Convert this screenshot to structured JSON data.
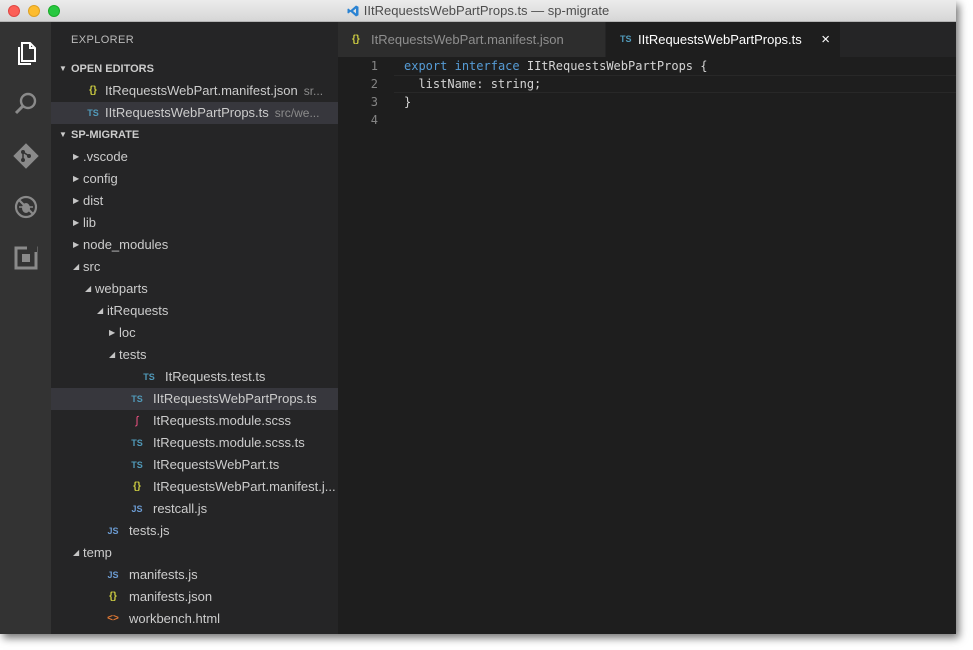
{
  "window": {
    "title": "IItRequestsWebPartProps.ts — sp-migrate"
  },
  "activity_bar": {
    "icons": [
      "files-icon",
      "search-icon",
      "git-icon",
      "debug-icon",
      "extensions-icon"
    ]
  },
  "sidebar": {
    "title": "EXPLORER",
    "open_editors_label": "OPEN EDITORS",
    "open_editors": [
      {
        "icon": "{}",
        "icon_type": "json",
        "name": "ItRequestsWebPart.manifest.json",
        "path": "sr..."
      },
      {
        "icon": "TS",
        "icon_type": "ts",
        "name": "IItRequestsWebPartProps.ts",
        "path": "src/we..."
      }
    ],
    "project_label": "SP-MIGRATE",
    "tree": [
      {
        "depth": 0,
        "twisty": "closed",
        "name": ".vscode"
      },
      {
        "depth": 0,
        "twisty": "closed",
        "name": "config"
      },
      {
        "depth": 0,
        "twisty": "closed",
        "name": "dist"
      },
      {
        "depth": 0,
        "twisty": "closed",
        "name": "lib"
      },
      {
        "depth": 0,
        "twisty": "closed",
        "name": "node_modules"
      },
      {
        "depth": 0,
        "twisty": "open",
        "name": "src"
      },
      {
        "depth": 1,
        "twisty": "open",
        "name": "webparts"
      },
      {
        "depth": 2,
        "twisty": "open",
        "name": "itRequests"
      },
      {
        "depth": 3,
        "twisty": "closed",
        "name": "loc"
      },
      {
        "depth": 3,
        "twisty": "open",
        "name": "tests"
      },
      {
        "depth": 4,
        "icon": "TS",
        "icon_type": "ts",
        "name": "ItRequests.test.ts"
      },
      {
        "depth": 3,
        "icon": "TS",
        "icon_type": "ts",
        "name": "IItRequestsWebPartProps.ts",
        "selected": true
      },
      {
        "depth": 3,
        "icon": "∫",
        "icon_type": "scss",
        "name": "ItRequests.module.scss"
      },
      {
        "depth": 3,
        "icon": "TS",
        "icon_type": "ts",
        "name": "ItRequests.module.scss.ts"
      },
      {
        "depth": 3,
        "icon": "TS",
        "icon_type": "ts",
        "name": "ItRequestsWebPart.ts"
      },
      {
        "depth": 3,
        "icon": "{}",
        "icon_type": "json",
        "name": "ItRequestsWebPart.manifest.j..."
      },
      {
        "depth": 3,
        "icon": "JS",
        "icon_type": "js",
        "name": "restcall.js"
      },
      {
        "depth": 1,
        "icon": "JS",
        "icon_type": "js",
        "name": "tests.js"
      },
      {
        "depth": 0,
        "twisty": "open",
        "name": "temp"
      },
      {
        "depth": 1,
        "icon": "JS",
        "icon_type": "js",
        "name": "manifests.js"
      },
      {
        "depth": 1,
        "icon": "{}",
        "icon_type": "json",
        "name": "manifests.json"
      },
      {
        "depth": 1,
        "icon": "<>",
        "icon_type": "html",
        "name": "workbench.html"
      }
    ]
  },
  "tabs": [
    {
      "icon": "{}",
      "label": "ItRequestsWebPart.manifest.json",
      "active": false
    },
    {
      "icon": "TS",
      "label": "IItRequestsWebPartProps.ts",
      "active": true,
      "close": "×"
    }
  ],
  "editor": {
    "line_numbers": [
      "1",
      "2",
      "3",
      "4"
    ],
    "lines": [
      {
        "kw1": "export",
        "kw2": "interface",
        "rest": " IItRequestsWebPartProps {"
      },
      {
        "text": "  listName: string;"
      },
      {
        "text": "}"
      },
      {
        "text": ""
      }
    ]
  },
  "colors": {
    "activity_bar": "#333333",
    "sidebar": "#252526",
    "editor": "#1e1e1e",
    "keyword": "#569cd6"
  }
}
